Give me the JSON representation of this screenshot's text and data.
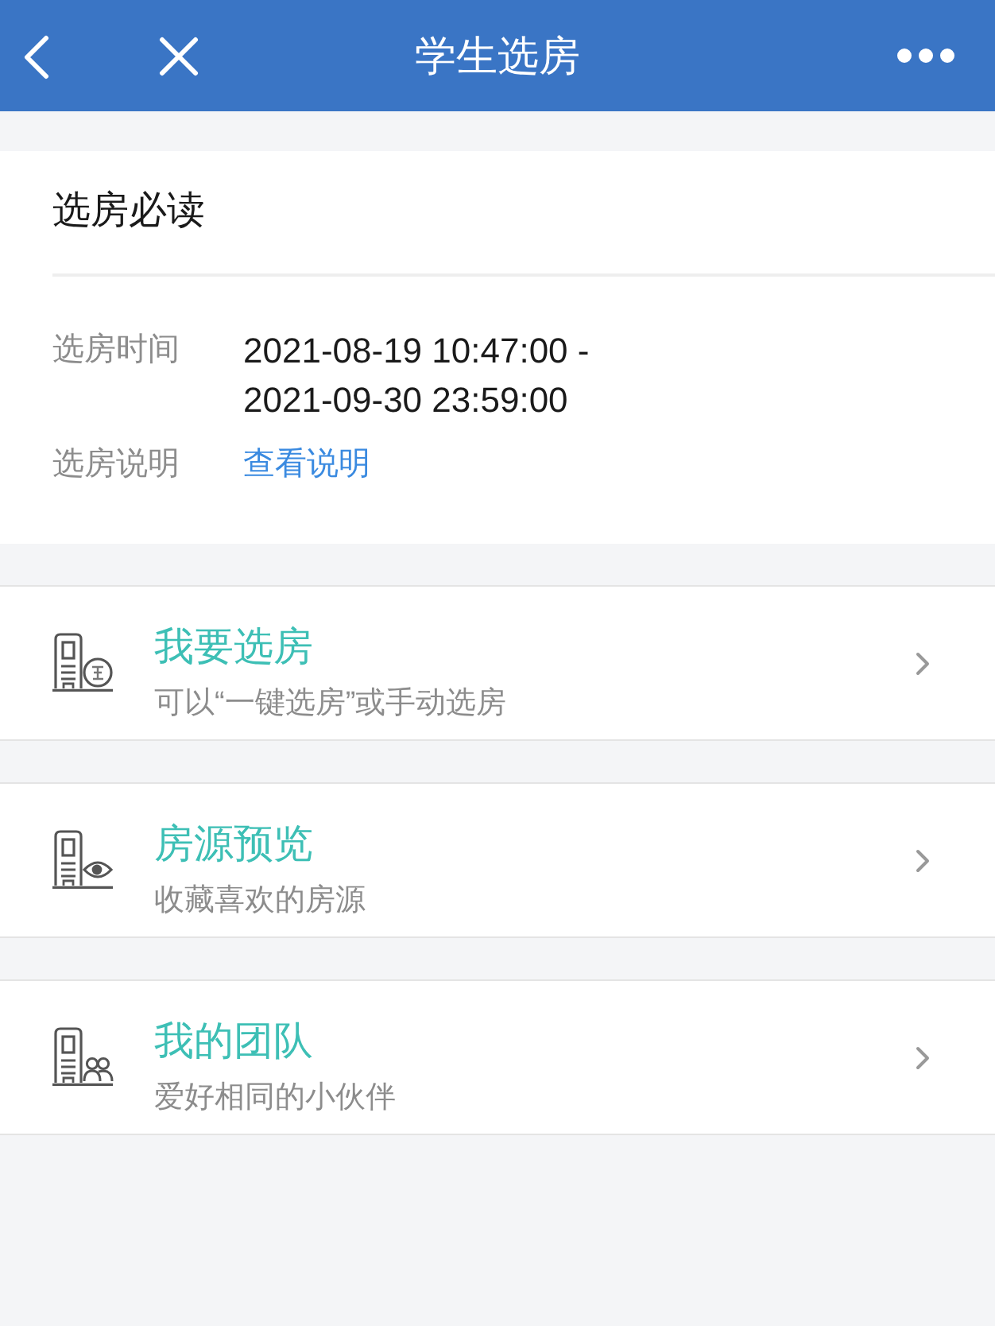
{
  "header": {
    "title": "学生选房"
  },
  "notice": {
    "title": "选房必读",
    "rows": [
      {
        "kind": "text",
        "label": "选房时间",
        "value": "2021-08-19 10:47:00 - 2021-09-30 23:59:00"
      },
      {
        "kind": "link",
        "label": "选房说明",
        "value": "查看说明"
      }
    ]
  },
  "menu": [
    {
      "kind": "select",
      "title": "我要选房",
      "subtitle": "可以“一键选房”或手动选房"
    },
    {
      "kind": "preview",
      "title": "房源预览",
      "subtitle": "收藏喜欢的房源"
    },
    {
      "kind": "team",
      "title": "我的团队",
      "subtitle": "爱好相同的小伙伴"
    }
  ]
}
